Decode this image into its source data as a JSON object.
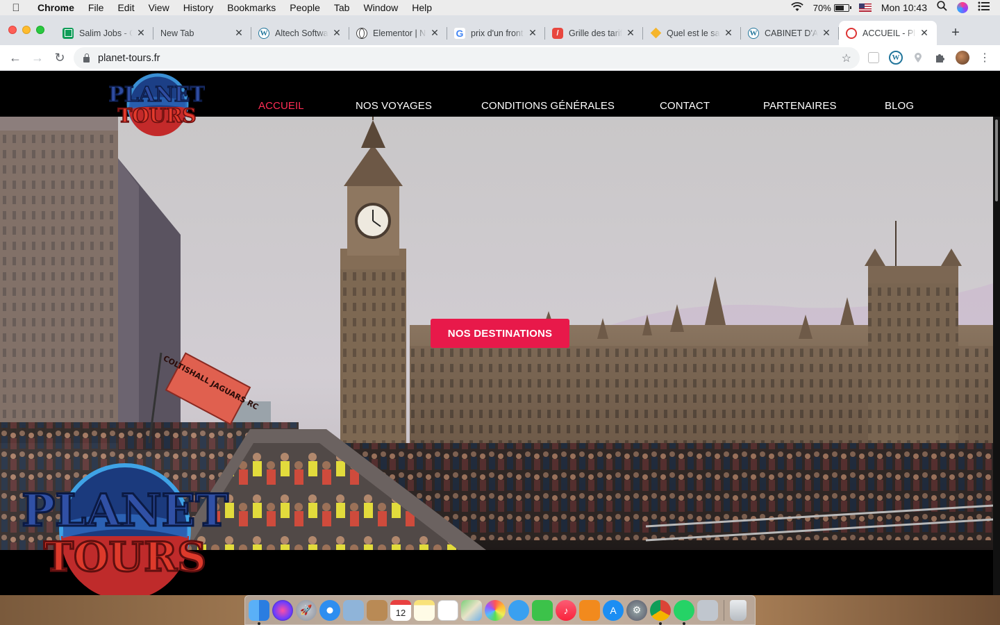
{
  "menubar": {
    "app": "Chrome",
    "items": [
      "File",
      "Edit",
      "View",
      "History",
      "Bookmarks",
      "People",
      "Tab",
      "Window",
      "Help"
    ],
    "battery": "70%",
    "clock": "Mon 10:43"
  },
  "browser": {
    "tabs": [
      {
        "title": "Salim Jobs - G",
        "icon": "sheets-icon"
      },
      {
        "title": "New Tab",
        "icon": ""
      },
      {
        "title": "Altech Softwa",
        "icon": "wordpress-icon"
      },
      {
        "title": "Elementor | N",
        "icon": "globe-icon"
      },
      {
        "title": "prix d'un front",
        "icon": "google-icon"
      },
      {
        "title": "Grille des tarif",
        "icon": "grille-icon"
      },
      {
        "title": "Quel est le sa",
        "icon": "diamond-icon"
      },
      {
        "title": "CABINET D'A",
        "icon": "wordpress-icon"
      },
      {
        "title": "ACCUEIL - Pl",
        "icon": "planet-tours-icon",
        "active": true
      }
    ],
    "url": "planet-tours.fr"
  },
  "site": {
    "logo": {
      "line1": "PLANET",
      "line2": "TOURS"
    },
    "nav": [
      {
        "label": "ACCUEIL",
        "active": true
      },
      {
        "label": "NOS VOYAGES"
      },
      {
        "label": "CONDITIONS GÉNÉRALES"
      },
      {
        "label": "CONTACT"
      },
      {
        "label": "PARTENAIRES"
      },
      {
        "label": "BLOG"
      }
    ],
    "hero": {
      "cta_label": "NOS DESTINATIONS",
      "banner_text": "COLTISHALL JAGUARS RC"
    },
    "colors": {
      "accent": "#e8194a",
      "nav_active": "#ff2d55",
      "header_bg": "#000000"
    }
  },
  "dock": {
    "calendar_day": "12",
    "apps": [
      "finder",
      "siri",
      "launchpad",
      "safari",
      "preview",
      "contacts",
      "calendar",
      "notes",
      "reminders",
      "maps",
      "photos",
      "messages",
      "facetime",
      "music",
      "books",
      "app-store",
      "system-preferences",
      "chrome",
      "whatsapp",
      "image-capture",
      "trash"
    ]
  }
}
